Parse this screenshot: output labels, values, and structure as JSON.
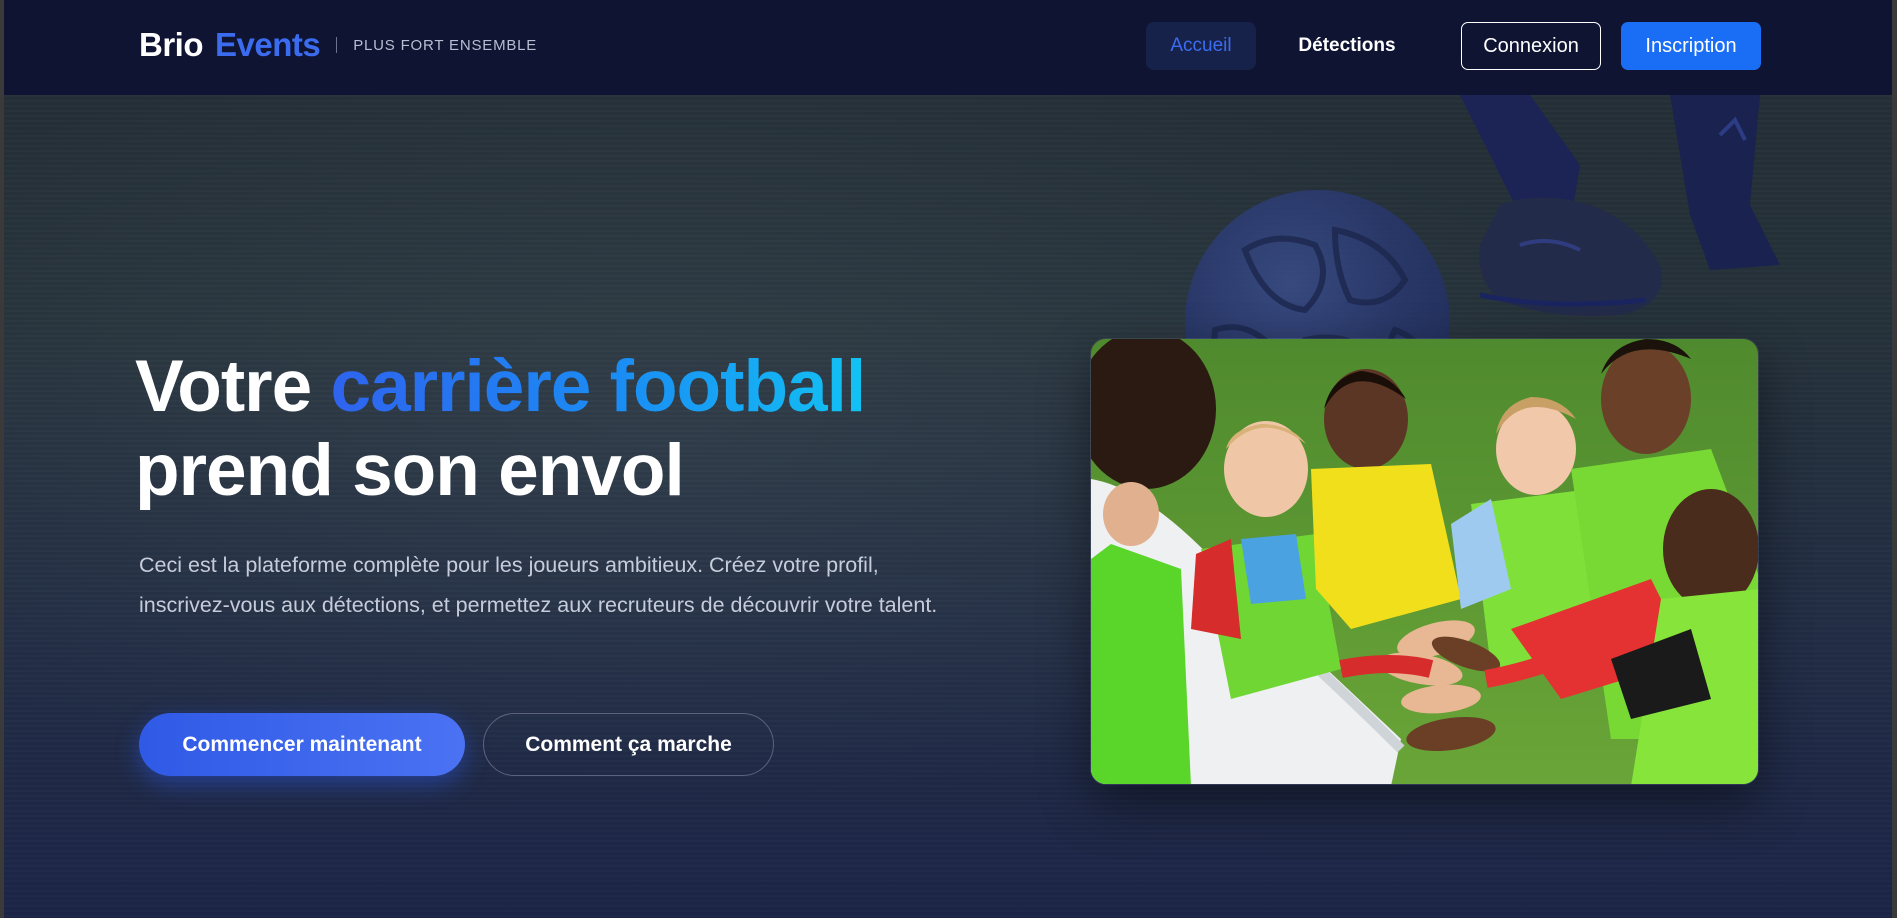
{
  "header": {
    "logo_brio": "Brio",
    "logo_events": "Events",
    "tagline": "PLUS FORT ENSEMBLE",
    "nav": {
      "home": "Accueil",
      "detections": "Détections"
    },
    "login": "Connexion",
    "signup": "Inscription"
  },
  "hero": {
    "title_part1": "Votre ",
    "title_highlight": "carrière football",
    "title_part2": "prend son envol",
    "description": "Ceci est la plateforme complète pour les joueurs ambitieux. Créez votre profil, inscrivez-vous aux détections, et permettez aux recruteurs de découvrir votre talent.",
    "cta_primary": "Commencer maintenant",
    "cta_secondary": "Comment ça marche"
  },
  "colors": {
    "accent": "#1a6ef5",
    "brand_blue": "#3b6cf0",
    "header_bg": "#0f1433",
    "gradient_end": "#12c3f3"
  },
  "images": {
    "hero_photo": "children-team-huddle-photo",
    "decor": [
      "soccer-ball",
      "player-legs"
    ]
  }
}
